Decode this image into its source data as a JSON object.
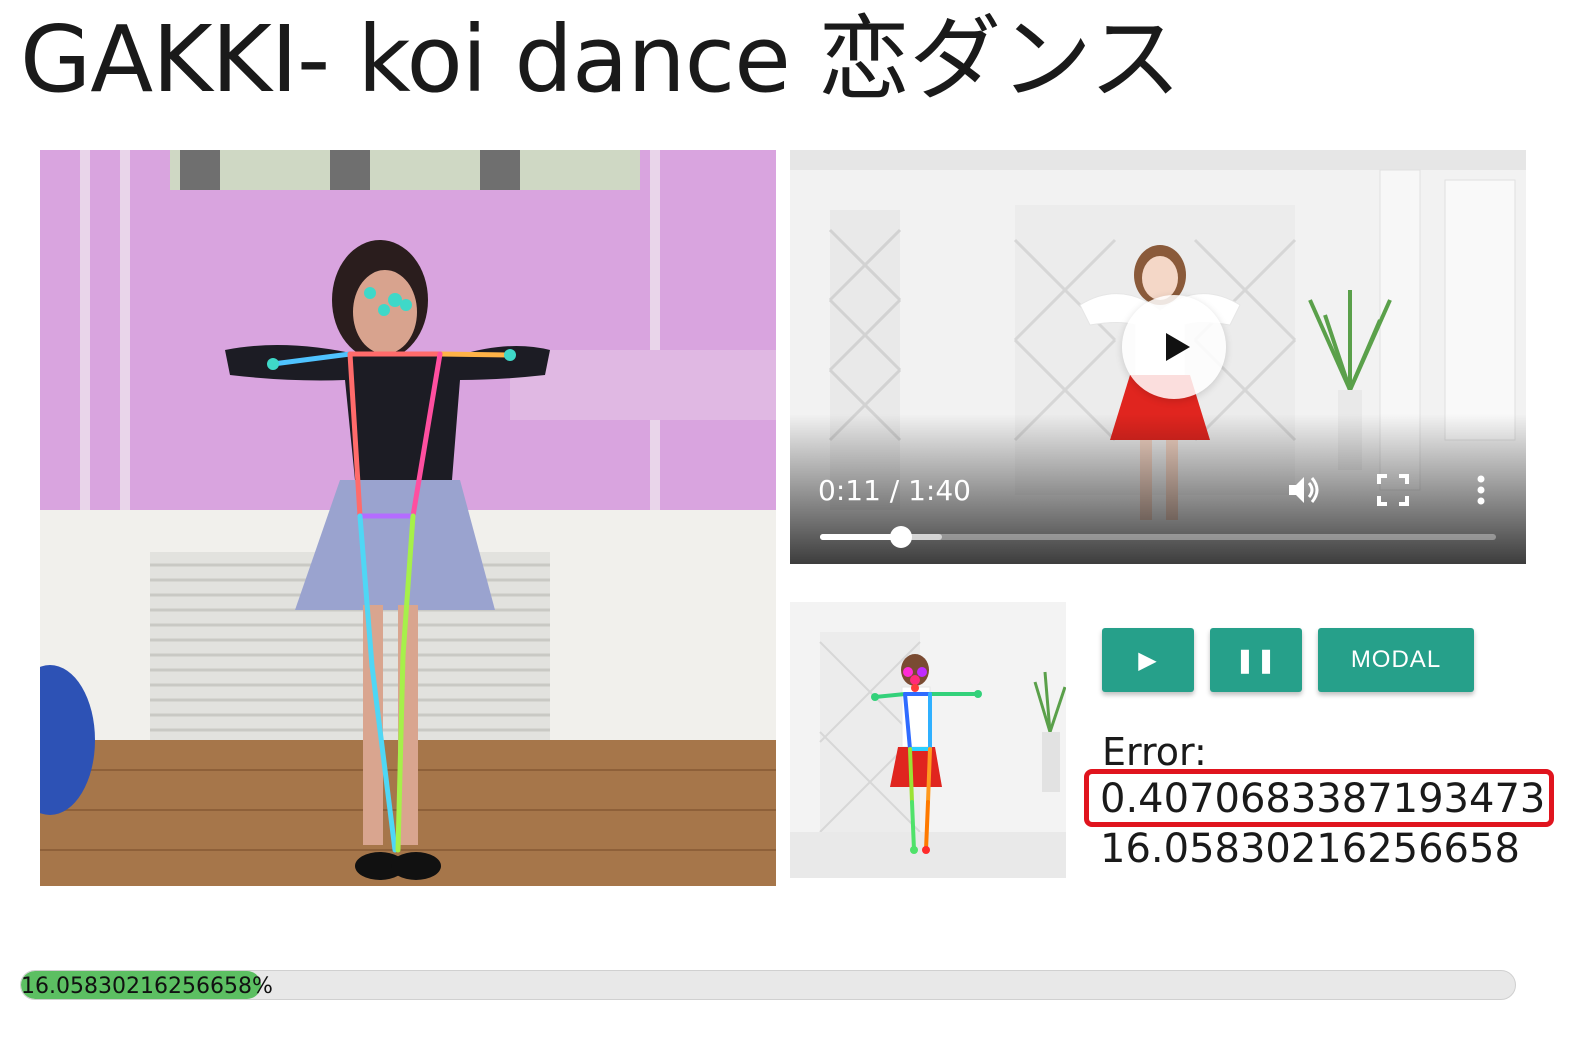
{
  "page": {
    "title": "GAKKI- koi dance 恋ダンス"
  },
  "player": {
    "time_display": "0:11 / 1:40",
    "played_fraction": 0.12,
    "buffered_fraction": 0.18
  },
  "controls": {
    "play_label": "▶",
    "pause_label": "❚❚",
    "modal_label": "MODAL"
  },
  "metrics": {
    "error_label": "Error:",
    "error_value": "0.4070683387193473",
    "score_value": "16.05830216256658"
  },
  "progress": {
    "text": "16.05830216256658%",
    "percent": 16.05830216256658
  },
  "colors": {
    "button": "#26a08a",
    "highlight_box": "#e0141e",
    "progress_fill": "#5cbf62"
  }
}
